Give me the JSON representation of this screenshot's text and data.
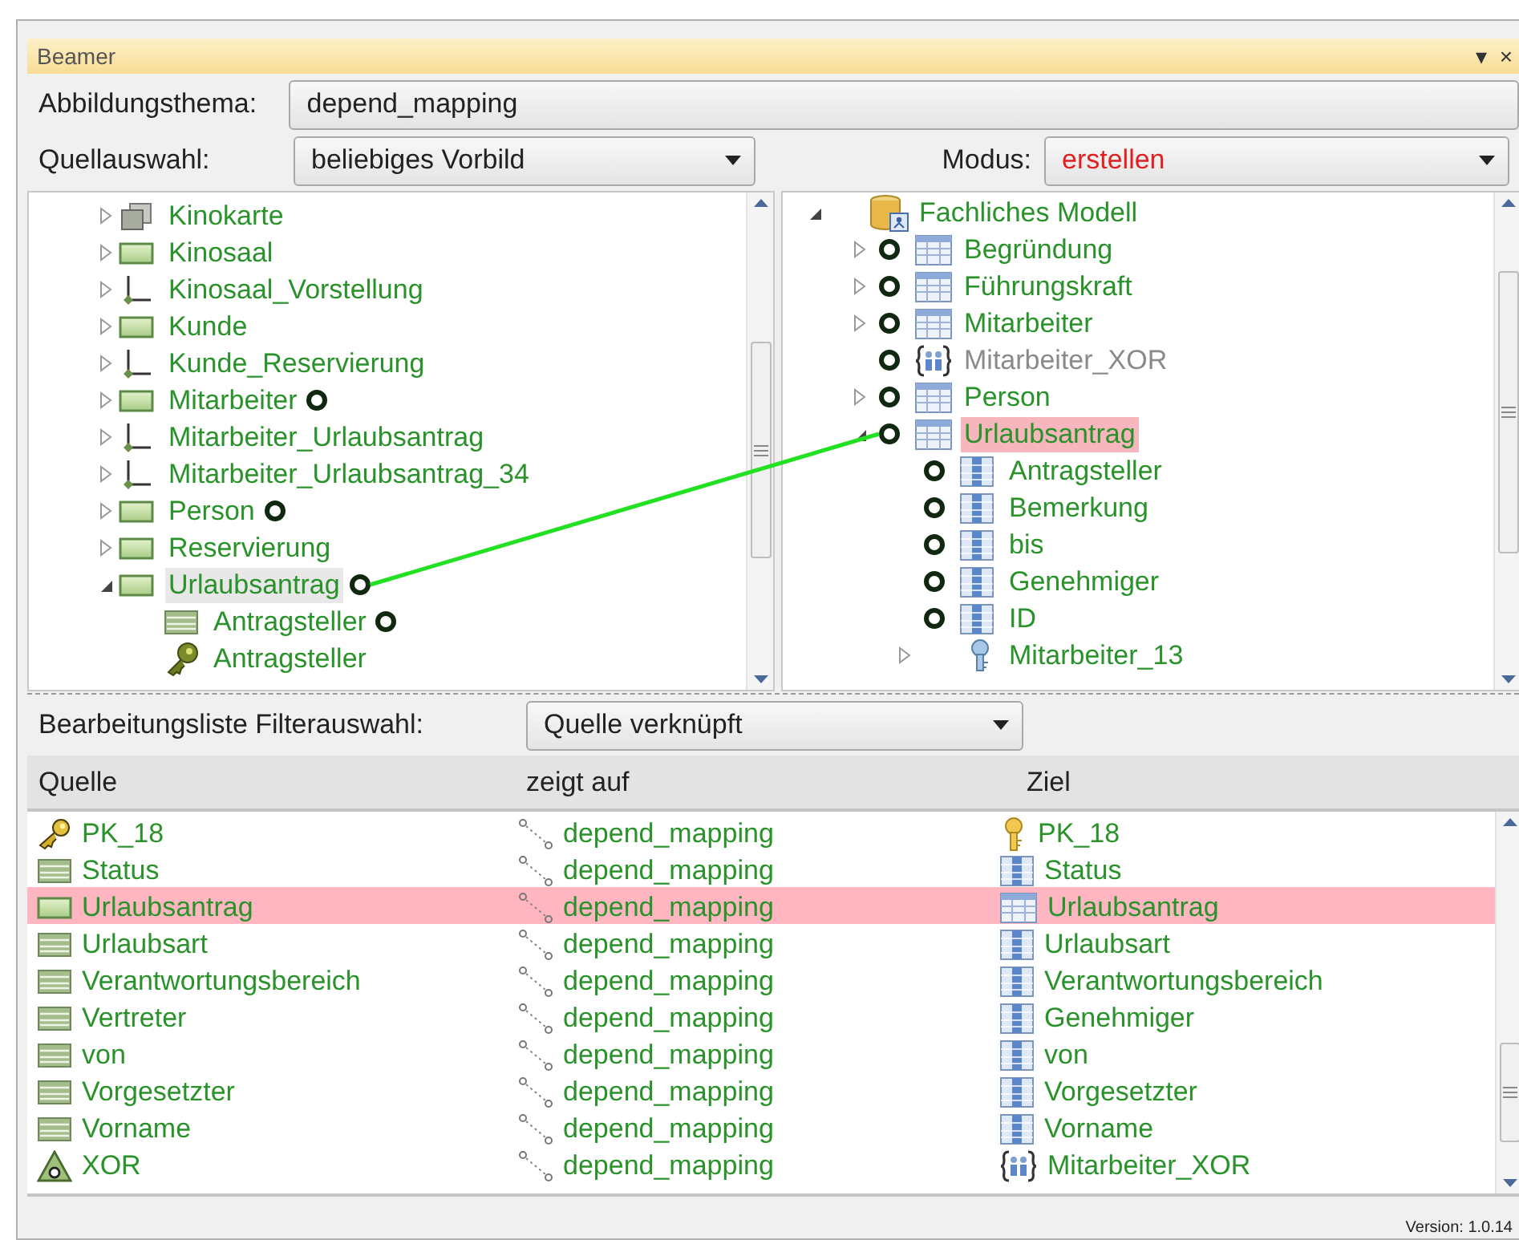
{
  "window": {
    "title": "Beamer",
    "controls": [
      "▾",
      "×"
    ]
  },
  "theme": {
    "label": "Abbildungsthema:",
    "value": "depend_mapping"
  },
  "source_select": {
    "label": "Quellauswahl:",
    "value": "beliebiges Vorbild"
  },
  "mode": {
    "label": "Modus:",
    "value": "erstellen"
  },
  "source_tree": [
    {
      "label": "Kinokarte",
      "kind": "view",
      "expanded": false,
      "linked": false,
      "selected": false
    },
    {
      "label": "Kinosaal",
      "kind": "entity",
      "expanded": false,
      "linked": false,
      "selected": false
    },
    {
      "label": "Kinosaal_Vorstellung",
      "kind": "relation",
      "expanded": false,
      "linked": false,
      "selected": false
    },
    {
      "label": "Kunde",
      "kind": "entity",
      "expanded": false,
      "linked": false,
      "selected": false
    },
    {
      "label": "Kunde_Reservierung",
      "kind": "relation",
      "expanded": false,
      "linked": false,
      "selected": false
    },
    {
      "label": "Mitarbeiter",
      "kind": "entity",
      "expanded": false,
      "linked": true,
      "selected": false
    },
    {
      "label": "Mitarbeiter_Urlaubsantrag",
      "kind": "relation",
      "expanded": false,
      "linked": false,
      "selected": false
    },
    {
      "label": "Mitarbeiter_Urlaubsantrag_34",
      "kind": "relation",
      "expanded": false,
      "linked": false,
      "selected": false
    },
    {
      "label": "Person",
      "kind": "entity",
      "expanded": false,
      "linked": true,
      "selected": false
    },
    {
      "label": "Reservierung",
      "kind": "entity",
      "expanded": false,
      "linked": false,
      "selected": false
    },
    {
      "label": "Urlaubsantrag",
      "kind": "entity",
      "expanded": true,
      "linked": true,
      "selected": true,
      "children": [
        {
          "label": "Antragsteller",
          "kind": "attribute",
          "linked": true,
          "selected": false
        },
        {
          "label": "Antragsteller",
          "kind": "key-reference",
          "linked": false,
          "selected": false
        }
      ]
    }
  ],
  "target_tree": [
    {
      "label": "Fachliches Modell",
      "kind": "database",
      "expanded": true,
      "linked": false,
      "selected": false,
      "disabled": false,
      "children": [
        {
          "label": "Begründung",
          "kind": "table",
          "expanded": false,
          "linked": true,
          "selected": false,
          "disabled": false
        },
        {
          "label": "Führungskraft",
          "kind": "table",
          "expanded": false,
          "linked": true,
          "selected": false,
          "disabled": false
        },
        {
          "label": "Mitarbeiter",
          "kind": "table",
          "expanded": false,
          "linked": true,
          "selected": false,
          "disabled": false
        },
        {
          "label": "Mitarbeiter_XOR",
          "kind": "xor-group",
          "linked": true,
          "selected": false,
          "disabled": true
        },
        {
          "label": "Person",
          "kind": "table",
          "expanded": false,
          "linked": true,
          "selected": false,
          "disabled": false
        },
        {
          "label": "Urlaubsantrag",
          "kind": "table",
          "expanded": true,
          "linked": true,
          "selected": true,
          "disabled": false,
          "children": [
            {
              "label": "Antragsteller",
              "kind": "column",
              "linked": true,
              "selected": false,
              "disabled": false
            },
            {
              "label": "Bemerkung",
              "kind": "column",
              "linked": true,
              "selected": false,
              "disabled": false
            },
            {
              "label": "bis",
              "kind": "column",
              "linked": true,
              "selected": false,
              "disabled": false
            },
            {
              "label": "Genehmiger",
              "kind": "column",
              "linked": true,
              "selected": false,
              "disabled": false
            },
            {
              "label": "ID",
              "kind": "column",
              "linked": true,
              "selected": false,
              "disabled": false
            },
            {
              "label": "Mitarbeiter_13",
              "kind": "foreign-reference",
              "expanded": false,
              "linked": false,
              "selected": false,
              "disabled": false
            }
          ]
        }
      ]
    }
  ],
  "filter": {
    "label": "Bearbeitungsliste Filterauswahl:",
    "value": "Quelle verknüpft"
  },
  "table": {
    "columns": [
      "Quelle",
      "zeigt auf",
      "Ziel"
    ],
    "rows": [
      {
        "source": {
          "kind": "key",
          "text": "PK_18"
        },
        "mapping": "depend_mapping",
        "target": {
          "kind": "key-upright",
          "text": "PK_18"
        },
        "selected": false
      },
      {
        "source": {
          "kind": "attribute",
          "text": "Status"
        },
        "mapping": "depend_mapping",
        "target": {
          "kind": "column",
          "text": "Status"
        },
        "selected": false
      },
      {
        "source": {
          "kind": "entity",
          "text": "Urlaubsantrag"
        },
        "mapping": "depend_mapping",
        "target": {
          "kind": "table",
          "text": "Urlaubsantrag"
        },
        "selected": true
      },
      {
        "source": {
          "kind": "attribute",
          "text": "Urlaubsart"
        },
        "mapping": "depend_mapping",
        "target": {
          "kind": "column",
          "text": "Urlaubsart"
        },
        "selected": false
      },
      {
        "source": {
          "kind": "attribute",
          "text": "Verantwortungsbereich"
        },
        "mapping": "depend_mapping",
        "target": {
          "kind": "column",
          "text": "Verantwortungsbereich"
        },
        "selected": false
      },
      {
        "source": {
          "kind": "attribute",
          "text": "Vertreter"
        },
        "mapping": "depend_mapping",
        "target": {
          "kind": "column",
          "text": "Genehmiger"
        },
        "selected": false
      },
      {
        "source": {
          "kind": "attribute",
          "text": "von"
        },
        "mapping": "depend_mapping",
        "target": {
          "kind": "column",
          "text": "von"
        },
        "selected": false
      },
      {
        "source": {
          "kind": "attribute",
          "text": "Vorgesetzter"
        },
        "mapping": "depend_mapping",
        "target": {
          "kind": "column",
          "text": "Vorgesetzter"
        },
        "selected": false
      },
      {
        "source": {
          "kind": "attribute",
          "text": "Vorname"
        },
        "mapping": "depend_mapping",
        "target": {
          "kind": "column",
          "text": "Vorname"
        },
        "selected": false
      },
      {
        "source": {
          "kind": "xor-triangle",
          "text": "XOR"
        },
        "mapping": "depend_mapping",
        "target": {
          "kind": "xor-group",
          "text": "Mitarbeiter_XOR"
        },
        "selected": false
      }
    ]
  },
  "version": "Version: 1.0.14"
}
